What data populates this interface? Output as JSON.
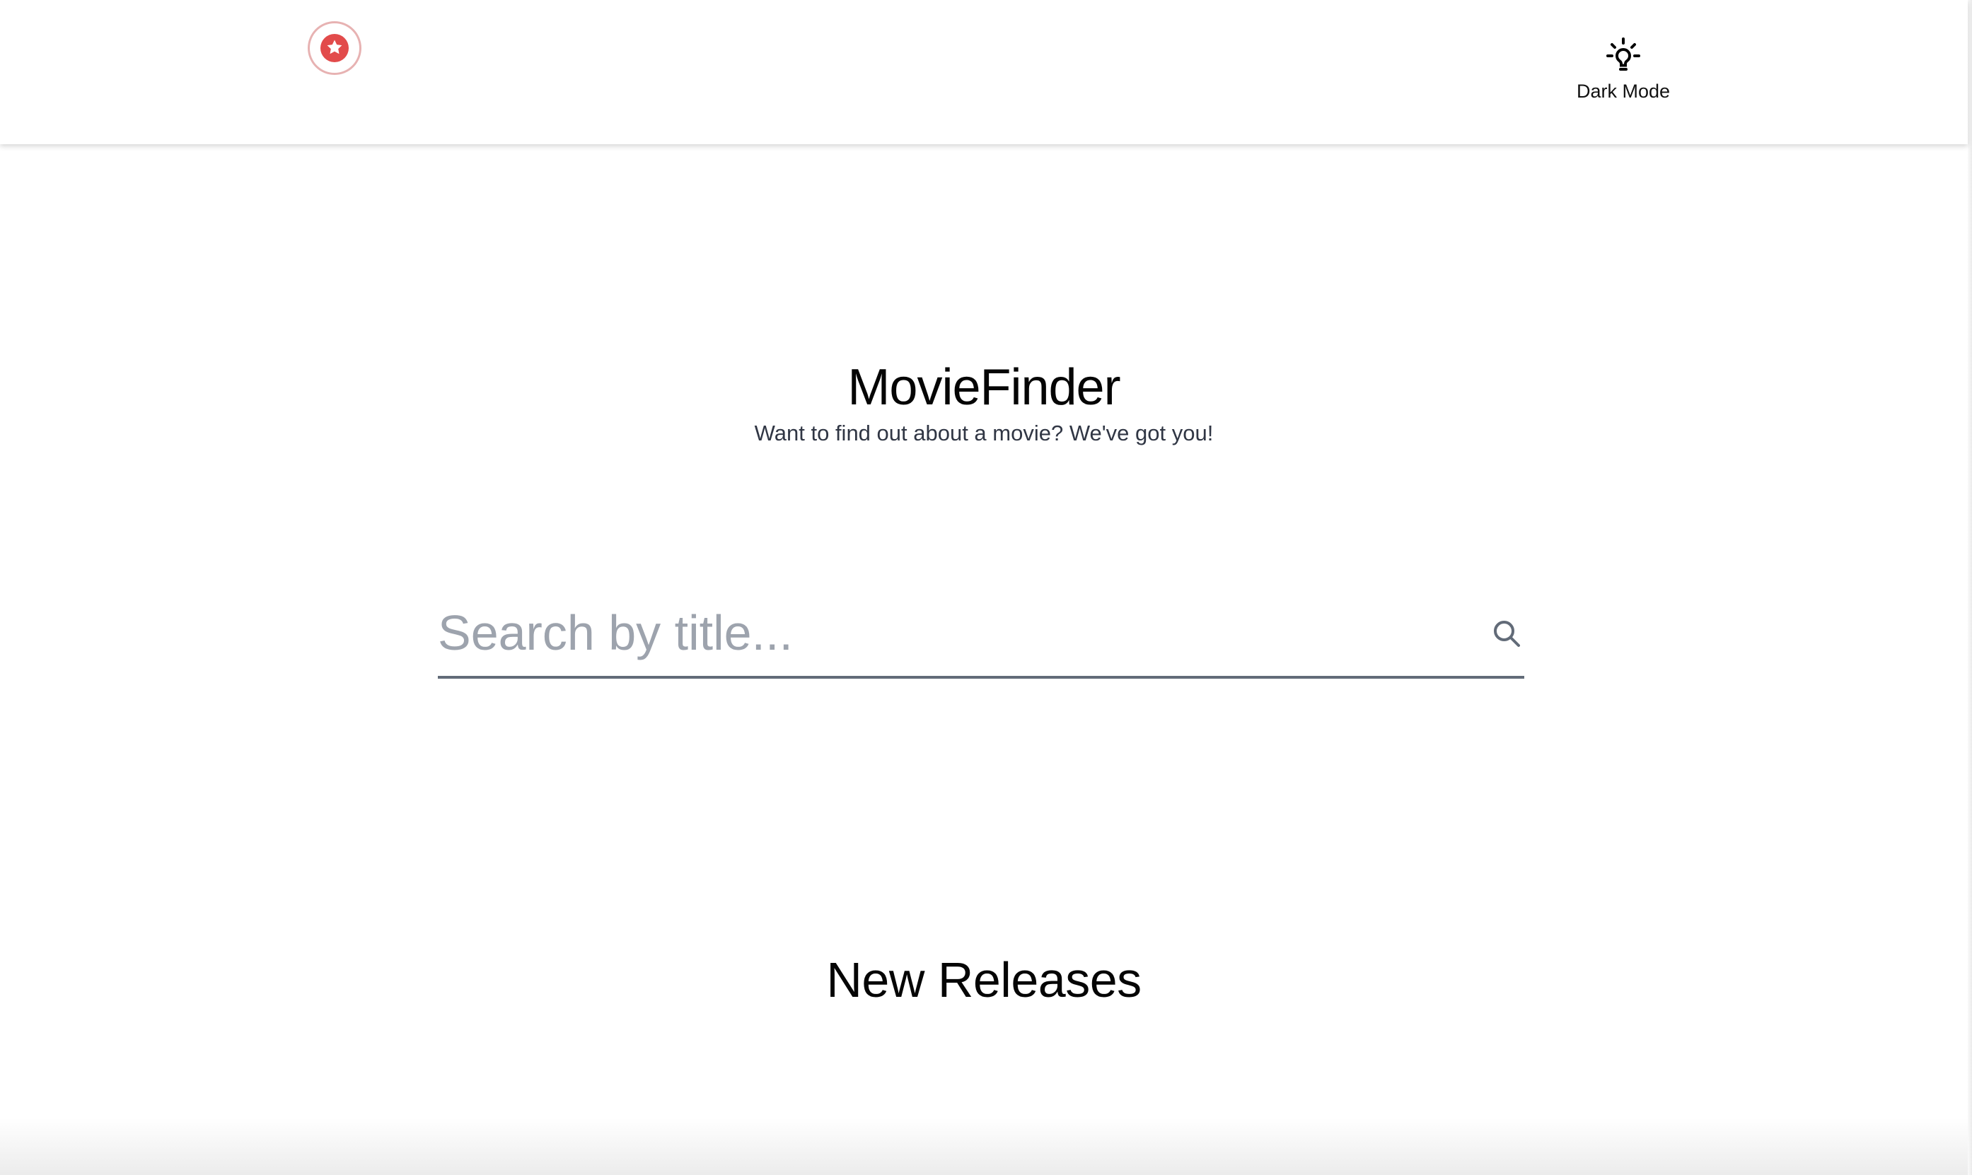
{
  "header": {
    "favorites_icon": "star-badge-icon",
    "dark_mode": {
      "icon": "lightbulb-icon",
      "label": "Dark Mode"
    }
  },
  "hero": {
    "title": "MovieFinder",
    "subtitle": "Want to find out about a movie? We've got you!"
  },
  "search": {
    "placeholder": "Search by title...",
    "value": "",
    "icon": "search-icon"
  },
  "sections": {
    "new_releases_title": "New Releases"
  },
  "colors": {
    "brand_red": "#E24B4B",
    "text_primary": "#050505",
    "text_secondary": "#303644",
    "placeholder": "#9DA3AD",
    "search_underline": "#626B78"
  }
}
